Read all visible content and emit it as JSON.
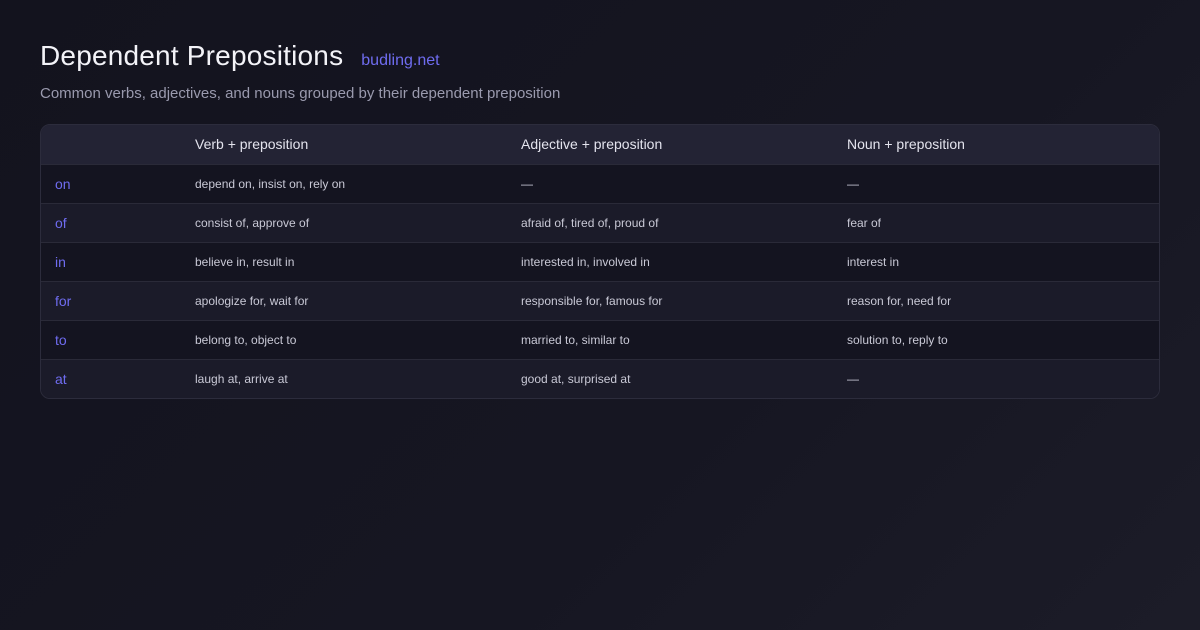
{
  "header": {
    "title": "Dependent Prepositions",
    "brand": "budling.net",
    "subtitle": "Common verbs, adjectives, and nouns grouped by their dependent preposition"
  },
  "table": {
    "columns": [
      "",
      "Verb + preposition",
      "Adjective + preposition",
      "Noun + preposition"
    ],
    "rows": [
      {
        "prep": "on",
        "verb": "depend on, insist on, rely on",
        "adjective": "—",
        "noun": "—"
      },
      {
        "prep": "of",
        "verb": "consist of, approve of",
        "adjective": "afraid of, tired of, proud of",
        "noun": "fear of"
      },
      {
        "prep": "in",
        "verb": "believe in, result in",
        "adjective": "interested in, involved in",
        "noun": "interest in"
      },
      {
        "prep": "for",
        "verb": "apologize for, wait for",
        "adjective": "responsible for, famous for",
        "noun": "reason for, need for"
      },
      {
        "prep": "to",
        "verb": "belong to, object to",
        "adjective": "married to, similar to",
        "noun": "solution to, reply to"
      },
      {
        "prep": "at",
        "verb": "laugh at, arrive at",
        "adjective": "good at, surprised at",
        "noun": "—"
      }
    ]
  },
  "colors": {
    "accent": "#6f6cf0",
    "background": "#13131e",
    "header_row": "#232334"
  }
}
